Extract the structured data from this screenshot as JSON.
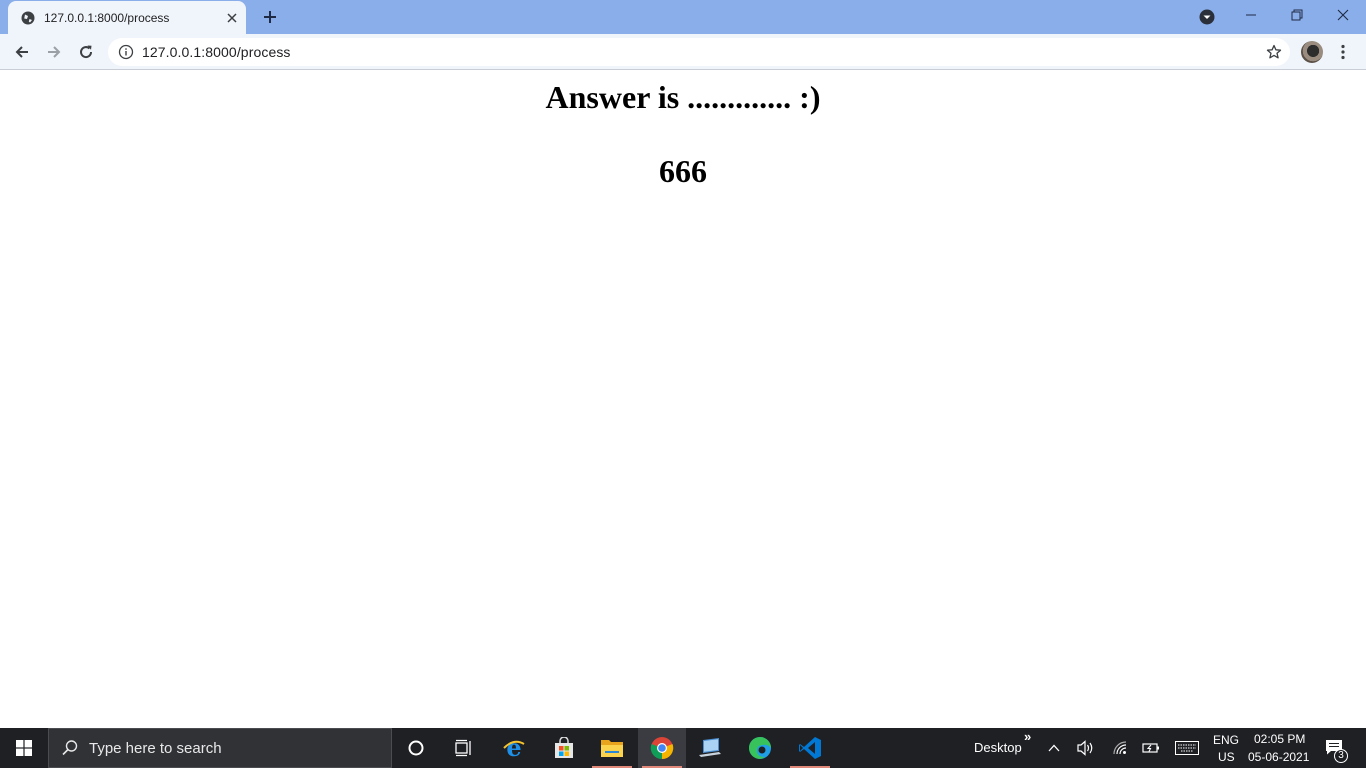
{
  "browser": {
    "tab": {
      "title": "127.0.0.1:8000/process"
    },
    "address_bar": {
      "url": "127.0.0.1:8000/process"
    }
  },
  "page": {
    "heading": "Answer is ............. :)",
    "answer": "666"
  },
  "taskbar": {
    "search_placeholder": "Type here to search",
    "desktop_label": "Desktop",
    "overflow_chevron": "»",
    "language_top": "ENG",
    "language_bottom": "US",
    "time": "02:05 PM",
    "date": "05-06-2021",
    "notification_count": "3"
  }
}
